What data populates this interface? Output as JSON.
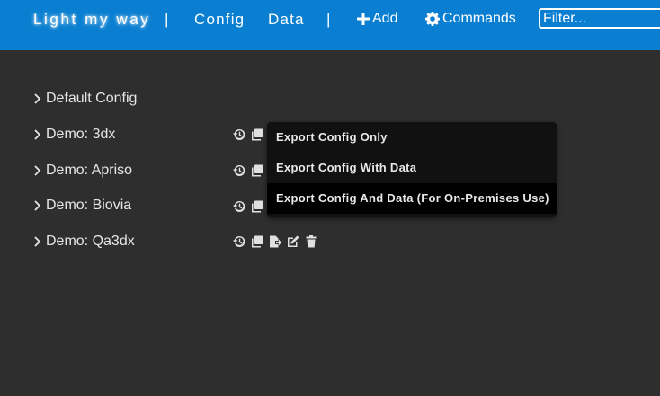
{
  "header": {
    "brand": "Light my way",
    "sep1": "|",
    "nav_config": "Config",
    "nav_data": "Data",
    "sep2": "|",
    "add_label": "Add",
    "add_icon": "plus-icon",
    "commands_label": "Commands",
    "commands_icon": "gear-icon",
    "filter_placeholder": "Filter...",
    "filter_value": ""
  },
  "configs": [
    {
      "label": "Default Config",
      "tools": []
    },
    {
      "label": "Demo: 3dx",
      "tools": [
        "history-icon",
        "copy-icon"
      ]
    },
    {
      "label": "Demo: Apriso",
      "tools": [
        "history-icon",
        "copy-icon"
      ]
    },
    {
      "label": "Demo: Biovia",
      "tools": [
        "history-icon",
        "copy-icon"
      ]
    },
    {
      "label": "Demo: Qa3dx",
      "tools": [
        "history-icon",
        "copy-icon",
        "export-icon",
        "edit-icon",
        "trash-icon"
      ]
    }
  ],
  "export_menu": {
    "items": [
      "Export Config Only",
      "Export Config With Data",
      "Export Config And Data (For On-Premises Use)"
    ],
    "highlighted": "Export Config And Data (For On-Premises Use)"
  },
  "colors": {
    "header_bg": "#0a7fd1",
    "page_bg": "#2e2e2e",
    "menu_bg": "#111111",
    "menu_hover_bg": "#000000",
    "text": "#e6e6e6"
  }
}
